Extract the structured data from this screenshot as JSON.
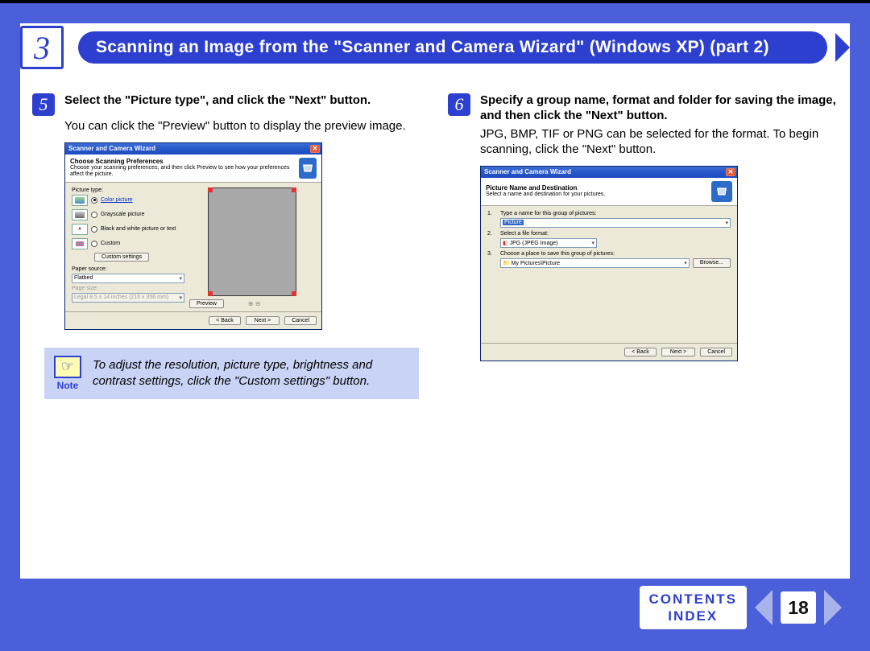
{
  "header": {
    "chapter_number": "3",
    "title": "Scanning an Image from the \"Scanner and Camera Wizard\" (Windows XP) (part 2)"
  },
  "steps": {
    "left": {
      "number": "5",
      "title": "Select the \"Picture type\", and click the \"Next\" button.",
      "body": "You can click the \"Preview\" button to display the preview image."
    },
    "right": {
      "number": "6",
      "title": "Specify a group name, format and folder for saving the image, and then click the \"Next\" button.",
      "body": "JPG, BMP, TIF or PNG can be selected for the format. To begin scanning, click the \"Next\" button."
    }
  },
  "dialog1": {
    "title": "Scanner and Camera Wizard",
    "section_title": "Choose Scanning Preferences",
    "section_sub": "Choose your scanning preferences, and then click Preview to see how your preferences affect the picture.",
    "picture_type_label": "Picture type:",
    "options": {
      "color": "Color picture",
      "gray": "Grayscale picture",
      "bw": "Black and white picture or text",
      "custom": "Custom"
    },
    "custom_settings": "Custom settings",
    "paper_source_label": "Paper source:",
    "paper_source": "Flatbed",
    "page_size_label": "Page size:",
    "page_size": "Legal 8.5 x 14 inches (216 x 356 mm)",
    "preview_btn": "Preview",
    "back_btn": "< Back",
    "next_btn": "Next >",
    "cancel_btn": "Cancel"
  },
  "dialog2": {
    "title": "Scanner and Camera Wizard",
    "section_title": "Picture Name and Destination",
    "section_sub": "Select a name and destination for your pictures.",
    "q1": "Type a name for this group of pictures:",
    "name_value": "Picture",
    "q2": "Select a file format:",
    "format_value": "JPG (JPEG Image)",
    "q3": "Choose a place to save this group of pictures:",
    "dest_value": "My Pictures\\Picture",
    "browse_btn": "Browse...",
    "back_btn": "< Back",
    "next_btn": "Next >",
    "cancel_btn": "Cancel"
  },
  "note": {
    "label": "Note",
    "text": "To adjust the resolution, picture type, brightness and contrast settings, click the \"Custom settings\" button."
  },
  "footer": {
    "contents": "CONTENTS",
    "index": "INDEX",
    "page_number": "18"
  }
}
